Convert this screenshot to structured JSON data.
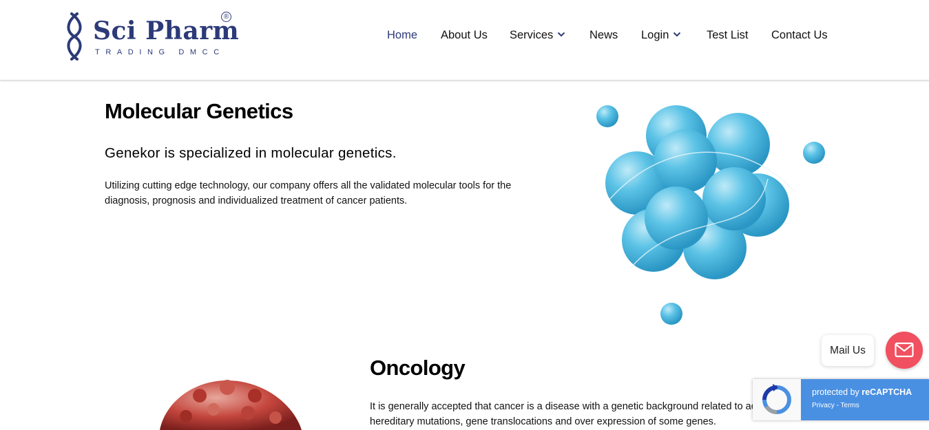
{
  "brand": {
    "name": "Sci Pharm",
    "subtitle": "TRADING DMCC",
    "registered": "®",
    "color": "#2c3a78"
  },
  "nav": {
    "items": [
      {
        "label": "Home",
        "active": true
      },
      {
        "label": "About Us"
      },
      {
        "label": "Services",
        "dropdown": true
      },
      {
        "label": "News"
      },
      {
        "label": "Login",
        "dropdown": true
      },
      {
        "label": "Test List"
      },
      {
        "label": "Contact Us"
      }
    ]
  },
  "molecular": {
    "title": "Molecular Genetics",
    "subtitle": "Genekor is specialized in molecular genetics.",
    "body": "Utilizing cutting edge technology, our company offers all the validated molecular tools for the diagnosis, prognosis and individualized treatment of cancer patients."
  },
  "oncology": {
    "title": "Oncology",
    "body": "It is generally accepted that cancer is a disease with a genetic background related to acquired or hereditary mutations, gene translocations and over expression of some genes."
  },
  "mail_widget": {
    "label": "Mail Us",
    "accent": "#f0505f"
  },
  "recaptcha": {
    "line1_prefix": "protected by ",
    "line1_brand": "reCAPTCHA",
    "privacy": "Privacy",
    "separator": " - ",
    "terms": "Terms",
    "accent": "#4a90e2"
  }
}
